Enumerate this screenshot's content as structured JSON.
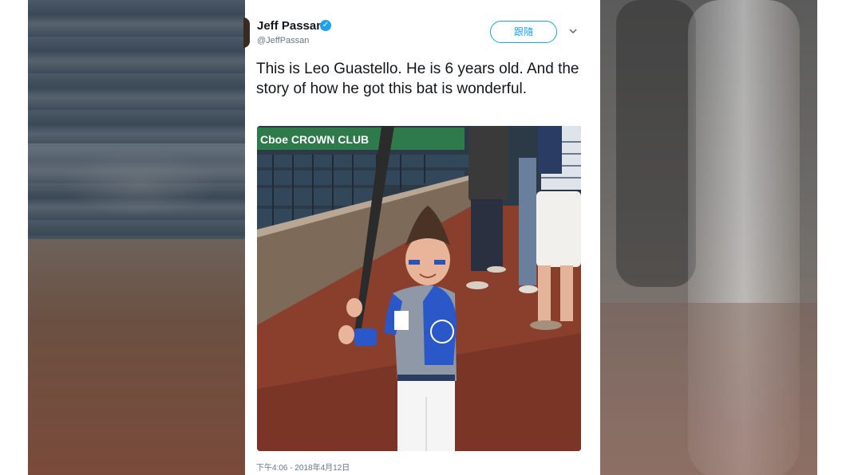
{
  "tweet": {
    "author_name": "Jeff Passan",
    "handle": "@JeffPassan",
    "follow_label": "跟隨",
    "text": "This is Leo Guastello. He is 6 years old. And the story of how he got this bat is wonderful.",
    "timestamp": "下午4:06 - 2018年4月12日",
    "verified": true
  },
  "photo": {
    "banner_text": "Cboe CROWN CLUB"
  },
  "colors": {
    "accent": "#1da1f2",
    "text": "#14171a",
    "muted": "#657786",
    "dirt": "#8a3f2c"
  },
  "icons": {
    "verified": "verified-badge-icon",
    "menu": "chevron-down-icon"
  }
}
